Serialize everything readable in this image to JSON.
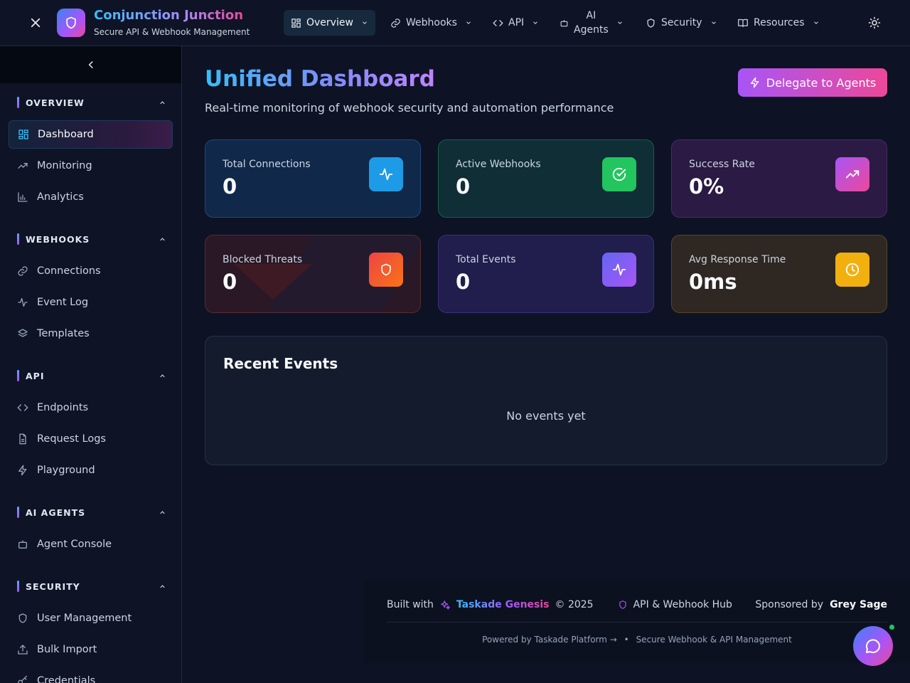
{
  "brand": {
    "title": "Conjunction Junction",
    "subtitle": "Secure API & Webhook Management"
  },
  "topnav": {
    "items": [
      {
        "label": "Overview",
        "icon": "grid-icon",
        "active": true
      },
      {
        "label": "Webhooks",
        "icon": "link-icon"
      },
      {
        "label": "API",
        "icon": "code-icon"
      },
      {
        "label": "AI Agents",
        "label_line1": "AI",
        "label_line2": "Agents",
        "icon": "bot-icon"
      },
      {
        "label": "Security",
        "icon": "shield-icon"
      },
      {
        "label": "Resources",
        "icon": "book-icon"
      }
    ]
  },
  "sidebar": {
    "sections": [
      {
        "label": "OVERVIEW",
        "items": [
          {
            "label": "Dashboard",
            "icon": "grid-icon",
            "active": true
          },
          {
            "label": "Monitoring",
            "icon": "trending-up-icon"
          },
          {
            "label": "Analytics",
            "icon": "bar-chart-icon"
          }
        ]
      },
      {
        "label": "WEBHOOKS",
        "items": [
          {
            "label": "Connections",
            "icon": "link-icon"
          },
          {
            "label": "Event Log",
            "icon": "activity-icon"
          },
          {
            "label": "Templates",
            "icon": "layers-icon"
          }
        ]
      },
      {
        "label": "API",
        "items": [
          {
            "label": "Endpoints",
            "icon": "code-icon"
          },
          {
            "label": "Request Logs",
            "icon": "file-text-icon"
          },
          {
            "label": "Playground",
            "icon": "zap-icon"
          }
        ]
      },
      {
        "label": "AI AGENTS",
        "items": [
          {
            "label": "Agent Console",
            "icon": "bot-icon"
          }
        ]
      },
      {
        "label": "SECURITY",
        "items": [
          {
            "label": "User Management",
            "icon": "shield-icon"
          },
          {
            "label": "Bulk Import",
            "icon": "upload-icon"
          },
          {
            "label": "Credentials",
            "icon": "key-icon"
          }
        ]
      }
    ]
  },
  "main": {
    "title": "Unified Dashboard",
    "subtitle": "Real-time monitoring of webhook security and automation performance",
    "delegate_label": "Delegate to Agents"
  },
  "stats": [
    {
      "label": "Total Connections",
      "value": "0",
      "icon": "activity-icon",
      "color": "#1e9be6"
    },
    {
      "label": "Active Webhooks",
      "value": "0",
      "icon": "check-circle-icon",
      "color": "#22c55e"
    },
    {
      "label": "Success Rate",
      "value": "0%",
      "icon": "trending-up-icon",
      "color": "#c04fe0"
    },
    {
      "label": "Blocked Threats",
      "value": "0",
      "icon": "shield-icon",
      "color": "#f25c1f"
    },
    {
      "label": "Total Events",
      "value": "0",
      "icon": "activity-icon",
      "color": "#7c5cf2"
    },
    {
      "label": "Avg Response Time",
      "value": "0ms",
      "icon": "clock-icon",
      "color": "#f2b00f"
    }
  ],
  "events": {
    "title": "Recent Events",
    "empty": "No events yet"
  },
  "footer": {
    "built_with": "Built with",
    "platform": "Taskade Genesis",
    "year": "© 2025",
    "hub": "API & Webhook Hub",
    "sponsored_by": "Sponsored by",
    "sponsor": "Grey Sage",
    "powered_by": "Powered by Taskade Platform →",
    "separator": "•",
    "tagline": "Secure Webhook & API Management"
  }
}
